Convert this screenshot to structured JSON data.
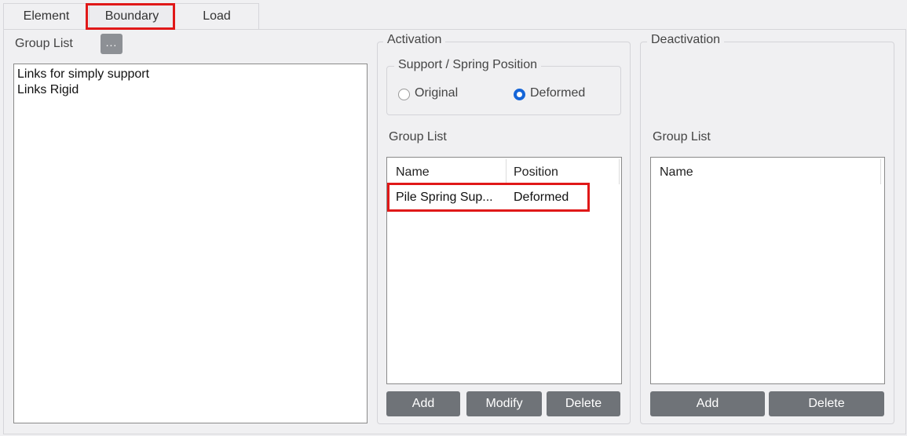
{
  "tabs": [
    {
      "label": "Element"
    },
    {
      "label": "Boundary"
    },
    {
      "label": "Load"
    }
  ],
  "left": {
    "group_list_label": "Group List",
    "browse_label": "...",
    "items": [
      "Links for simply support",
      "Links Rigid"
    ]
  },
  "activation": {
    "title": "Activation",
    "support_spring": {
      "title": "Support / Spring Position",
      "option_original": "Original",
      "option_deformed": "Deformed",
      "selected": "Deformed"
    },
    "group_list_label": "Group List",
    "columns": [
      "Name",
      "Position"
    ],
    "rows": [
      {
        "name": "Pile Spring Sup...",
        "position": "Deformed"
      }
    ],
    "buttons": {
      "add": "Add",
      "modify": "Modify",
      "delete": "Delete"
    }
  },
  "deactivation": {
    "title": "Deactivation",
    "group_list_label": "Group List",
    "columns": [
      "Name"
    ],
    "buttons": {
      "add": "Add",
      "delete": "Delete"
    }
  },
  "colors": {
    "highlight": "#e01818",
    "button": "#6f7378",
    "radio_selected": "#1565d8"
  }
}
